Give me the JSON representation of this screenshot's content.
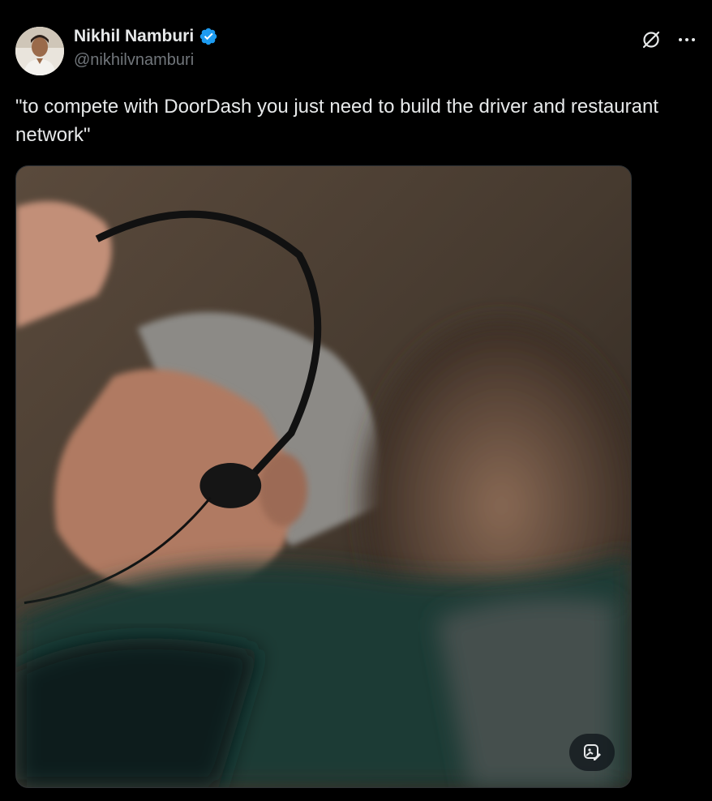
{
  "author": {
    "display_name": "Nikhil Namburi",
    "handle": "@nikhilvnamburi",
    "verified": true,
    "avatar_icon": "profile-photo"
  },
  "tweet": {
    "text": "\"to compete with DoorDash you just need to build the driver and restaurant network\""
  },
  "header_icons": [
    "grok-icon",
    "more-icon"
  ],
  "media": {
    "type": "photo",
    "badge_icon": "image-edit-icon"
  },
  "colors": {
    "background": "#000000",
    "text": "#e7e9ea",
    "secondary": "#71767b",
    "verified": "#1d9bf0"
  }
}
